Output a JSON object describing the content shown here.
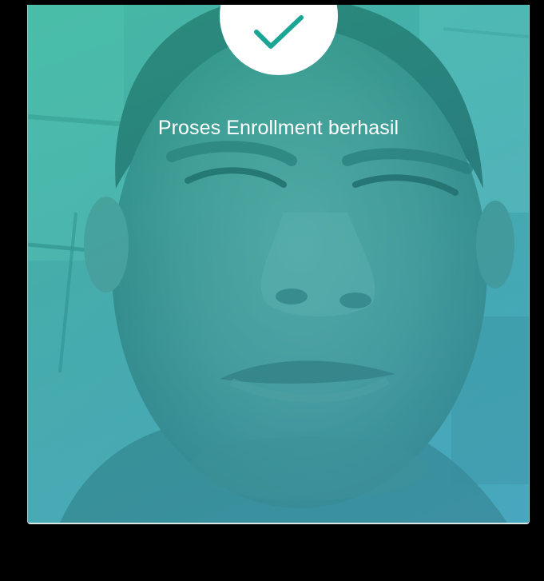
{
  "enrollment": {
    "status_message": "Proses Enrollment berhasil",
    "success_icon": "checkmark-icon"
  },
  "colors": {
    "accent_teal": "#1aa595",
    "overlay_tint": "#2bb5a6",
    "background": "#000000"
  }
}
